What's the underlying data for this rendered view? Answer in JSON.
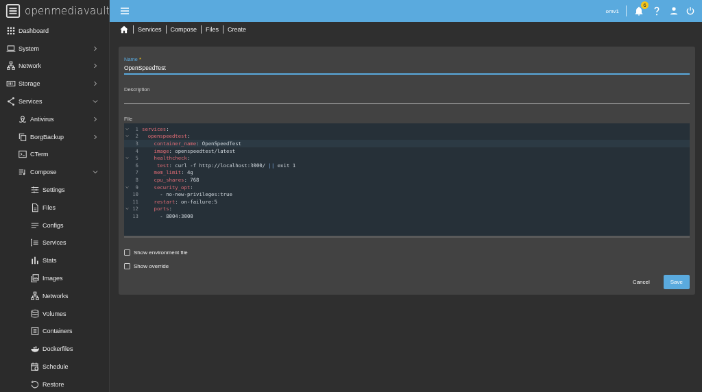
{
  "brand": "openmediavault",
  "sidebar": {
    "items": [
      {
        "label": "Dashboard"
      },
      {
        "label": "System",
        "expanded": false
      },
      {
        "label": "Network",
        "expanded": false
      },
      {
        "label": "Storage",
        "expanded": false
      },
      {
        "label": "Services",
        "expanded": true,
        "children": [
          {
            "label": "Antivirus",
            "expanded": false
          },
          {
            "label": "BorgBackup",
            "expanded": false
          },
          {
            "label": "CTerm"
          },
          {
            "label": "Compose",
            "expanded": true,
            "children": [
              {
                "label": "Settings"
              },
              {
                "label": "Files"
              },
              {
                "label": "Configs"
              },
              {
                "label": "Services"
              },
              {
                "label": "Stats"
              },
              {
                "label": "Images"
              },
              {
                "label": "Networks"
              },
              {
                "label": "Volumes"
              },
              {
                "label": "Containers"
              },
              {
                "label": "Dockerfiles"
              },
              {
                "label": "Schedule"
              },
              {
                "label": "Restore"
              }
            ]
          }
        ]
      }
    ]
  },
  "header": {
    "hostname": "omv1",
    "notification_count": "6"
  },
  "breadcrumb": [
    "Services",
    "Compose",
    "Files",
    "Create"
  ],
  "form": {
    "name": {
      "label": "Name",
      "required_mark": "*",
      "value": "OpenSpeedTest",
      "focused": true
    },
    "description": {
      "label": "Description"
    },
    "file": {
      "label": "File",
      "lines": [
        {
          "number": "1",
          "foldable": true,
          "active": false,
          "segments": [
            {
              "kind": "key",
              "text": "services"
            },
            {
              "kind": "plain",
              "text": ":"
            }
          ]
        },
        {
          "number": "2",
          "foldable": true,
          "active": false,
          "segments": [
            {
              "kind": "key",
              "text": "  openspeedtest"
            },
            {
              "kind": "plain",
              "text": ":"
            }
          ]
        },
        {
          "number": "3",
          "foldable": false,
          "active": true,
          "segments": [
            {
              "kind": "key",
              "text": "    container_name"
            },
            {
              "kind": "plain",
              "text": ": OpenSpeedTest"
            }
          ]
        },
        {
          "number": "4",
          "foldable": false,
          "active": false,
          "segments": [
            {
              "kind": "key",
              "text": "    image"
            },
            {
              "kind": "plain",
              "text": ": openspeedtest/latest"
            }
          ]
        },
        {
          "number": "5",
          "foldable": true,
          "active": false,
          "segments": [
            {
              "kind": "key",
              "text": "    healthcheck"
            },
            {
              "kind": "plain",
              "text": ":"
            }
          ]
        },
        {
          "number": "6",
          "foldable": false,
          "active": false,
          "segments": [
            {
              "kind": "key",
              "text": "     test"
            },
            {
              "kind": "plain",
              "text": ": curl -f http://localhost:3000/ "
            },
            {
              "kind": "operator",
              "text": "||"
            },
            {
              "kind": "plain",
              "text": " exit 1"
            }
          ]
        },
        {
          "number": "7",
          "foldable": false,
          "active": false,
          "segments": [
            {
              "kind": "key",
              "text": "    mem_limit"
            },
            {
              "kind": "plain",
              "text": ": 4g"
            }
          ]
        },
        {
          "number": "8",
          "foldable": false,
          "active": false,
          "segments": [
            {
              "kind": "key",
              "text": "    cpu_shares"
            },
            {
              "kind": "plain",
              "text": ": 768"
            }
          ]
        },
        {
          "number": "9",
          "foldable": true,
          "active": false,
          "segments": [
            {
              "kind": "key",
              "text": "    security_opt"
            },
            {
              "kind": "plain",
              "text": ":"
            }
          ]
        },
        {
          "number": "10",
          "foldable": false,
          "active": false,
          "segments": [
            {
              "kind": "plain",
              "text": "      - no-new-privileges:true"
            }
          ]
        },
        {
          "number": "11",
          "foldable": false,
          "active": false,
          "segments": [
            {
              "kind": "key",
              "text": "    restart"
            },
            {
              "kind": "plain",
              "text": ": on-failure:5"
            }
          ]
        },
        {
          "number": "12",
          "foldable": true,
          "active": false,
          "segments": [
            {
              "kind": "key",
              "text": "    ports"
            },
            {
              "kind": "plain",
              "text": ":"
            }
          ]
        },
        {
          "number": "13",
          "foldable": false,
          "active": false,
          "segments": [
            {
              "kind": "plain",
              "text": "      - 8004:3000"
            }
          ]
        }
      ]
    },
    "checkboxes": [
      {
        "label": "Show environment file",
        "checked": false
      },
      {
        "label": "Show override",
        "checked": false
      }
    ],
    "buttons": [
      {
        "label": "Cancel",
        "kind": "text"
      },
      {
        "label": "Save",
        "kind": "primary"
      }
    ]
  }
}
